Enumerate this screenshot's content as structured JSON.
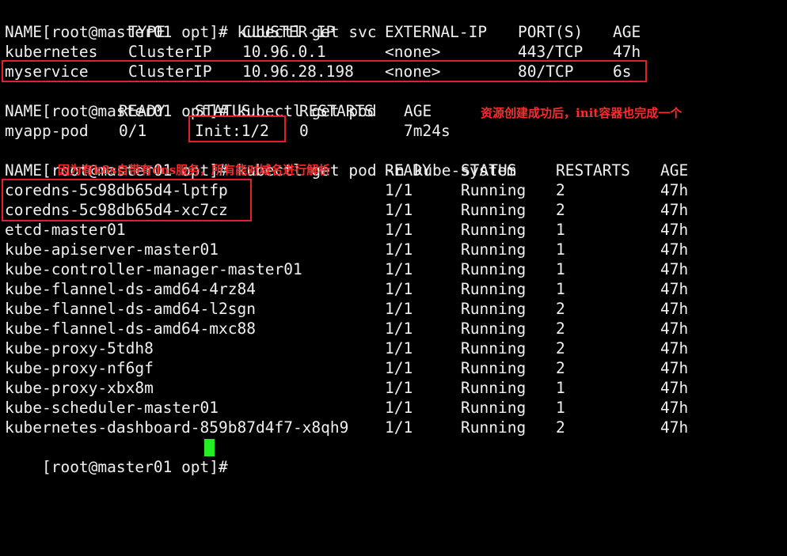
{
  "terminal": {
    "prompt": "[root@master01 opt]# ",
    "cursor_color": "#22ee22",
    "annotation_color": "#ff2a2a"
  },
  "svc": {
    "command": "kubectl get svc",
    "headers": [
      "NAME",
      "TYPE",
      "CLUSTER-IP",
      "EXTERNAL-IP",
      "PORT(S)",
      "AGE"
    ],
    "rows": [
      [
        "kubernetes",
        "ClusterIP",
        "10.96.0.1",
        "<none>",
        "443/TCP",
        "47h"
      ],
      [
        "myservice",
        "ClusterIP",
        "10.96.28.198",
        "<none>",
        "80/TCP",
        "6s"
      ]
    ]
  },
  "pod": {
    "command": "kubectl get pod",
    "headers": [
      "NAME",
      "READY",
      "STATUS",
      "RESTARTS",
      "AGE"
    ],
    "rows": [
      [
        "myapp-pod",
        "0/1",
        "Init:1/2",
        "0",
        "7m24s"
      ]
    ],
    "annotation": "资源创建成功后，init容器也完成一个"
  },
  "system": {
    "command": "kubectl get pod -n kube-system",
    "headers": [
      "NAME",
      "READY",
      "STATUS",
      "RESTARTS",
      "AGE"
    ],
    "annotation": "因为有k8s自带有dns服务，所有能对域名进行解析",
    "rows": [
      [
        "coredns-5c98db65d4-lptfp",
        "1/1",
        "Running",
        "2",
        "47h"
      ],
      [
        "coredns-5c98db65d4-xc7cz",
        "1/1",
        "Running",
        "2",
        "47h"
      ],
      [
        "etcd-master01",
        "1/1",
        "Running",
        "1",
        "47h"
      ],
      [
        "kube-apiserver-master01",
        "1/1",
        "Running",
        "1",
        "47h"
      ],
      [
        "kube-controller-manager-master01",
        "1/1",
        "Running",
        "1",
        "47h"
      ],
      [
        "kube-flannel-ds-amd64-4rz84",
        "1/1",
        "Running",
        "1",
        "47h"
      ],
      [
        "kube-flannel-ds-amd64-l2sgn",
        "1/1",
        "Running",
        "2",
        "47h"
      ],
      [
        "kube-flannel-ds-amd64-mxc88",
        "1/1",
        "Running",
        "2",
        "47h"
      ],
      [
        "kube-proxy-5tdh8",
        "1/1",
        "Running",
        "2",
        "47h"
      ],
      [
        "kube-proxy-nf6gf",
        "1/1",
        "Running",
        "2",
        "47h"
      ],
      [
        "kube-proxy-xbx8m",
        "1/1",
        "Running",
        "1",
        "47h"
      ],
      [
        "kube-scheduler-master01",
        "1/1",
        "Running",
        "1",
        "47h"
      ],
      [
        "kubernetes-dashboard-859b87d4f7-x8qh9",
        "1/1",
        "Running",
        "2",
        "47h"
      ]
    ]
  }
}
